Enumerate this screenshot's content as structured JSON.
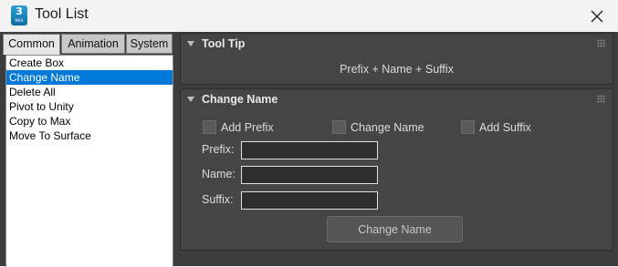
{
  "window": {
    "title": "Tool List",
    "icon_number": "3",
    "icon_text": "MAX"
  },
  "tabs": [
    {
      "label": "Common",
      "active": true
    },
    {
      "label": "Animation",
      "active": false
    },
    {
      "label": "System",
      "active": false
    }
  ],
  "tool_list": {
    "items": [
      "Create Box",
      "Change Name",
      "Delete All",
      "Pivot to Unity",
      "Copy to Max",
      "Move To Surface"
    ],
    "selected": "Change Name"
  },
  "tool_tip": {
    "title": "Tool Tip",
    "text": "Prefix + Name + Suffix"
  },
  "change_name": {
    "title": "Change Name",
    "checkboxes": {
      "add_prefix": {
        "label": "Add Prefix",
        "checked": false
      },
      "change_name": {
        "label": "Change Name",
        "checked": false
      },
      "add_suffix": {
        "label": "Add Suffix",
        "checked": false
      }
    },
    "fields": {
      "prefix": {
        "label": "Prefix:",
        "value": ""
      },
      "name": {
        "label": "Name:",
        "value": ""
      },
      "suffix": {
        "label": "Suffix:",
        "value": ""
      }
    },
    "button_label": "Change Name"
  },
  "colors": {
    "panel_bg": "#3d3d3d",
    "rollout_bg": "#454545",
    "selection": "#0078d7"
  }
}
